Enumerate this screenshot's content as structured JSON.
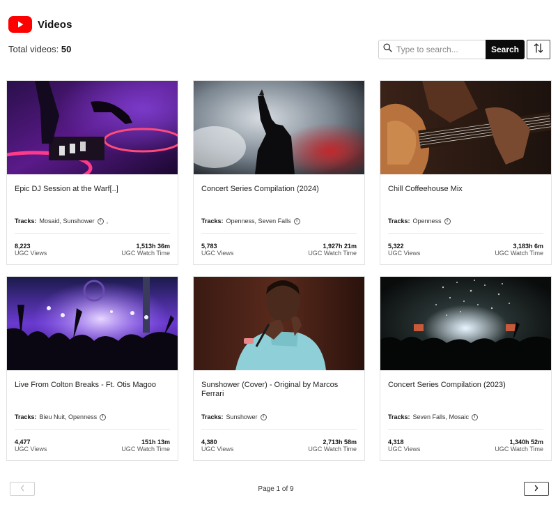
{
  "header": {
    "title": "Videos",
    "logo_icon": "youtube-logo-icon",
    "brand_color": "#ff0000"
  },
  "summary": {
    "label": "Total videos:",
    "count": "50"
  },
  "search": {
    "placeholder": "Type to search...",
    "button_label": "Search",
    "icon": "search-icon"
  },
  "sort": {
    "icon": "sort-arrows-icon"
  },
  "videos": [
    {
      "title": "Epic DJ Session at the Warf[..]",
      "tracks_label": "Tracks:",
      "tracks": "Mosaid, Sunshower",
      "tracks_suffix": ",",
      "views": "8,223",
      "views_label": "UGC Views",
      "watch_time": "1,513h 36m",
      "watch_label": "UGC Watch Time",
      "thumbnail": "dj-decks-purple"
    },
    {
      "title": "Concert Series Compilation (2024)",
      "tracks_label": "Tracks:",
      "tracks": "Openness, Seven Falls",
      "tracks_suffix": "",
      "views": "5,783",
      "views_label": "UGC Views",
      "watch_time": "1,927h 21m",
      "watch_label": "UGC Watch Time",
      "thumbnail": "singer-in-smoke"
    },
    {
      "title": "Chill Coffeehouse Mix",
      "tracks_label": "Tracks:",
      "tracks": "Openness",
      "tracks_suffix": "",
      "views": "5,322",
      "views_label": "UGC Views",
      "watch_time": "3,183h 6m",
      "watch_label": "UGC Watch Time",
      "thumbnail": "acoustic-guitar"
    },
    {
      "title": "Live From Colton Breaks - Ft. Otis Magoo",
      "tracks_label": "Tracks:",
      "tracks": "Bieu Nuit, Openness",
      "tracks_suffix": "",
      "views": "4,477",
      "views_label": "UGC Views",
      "watch_time": "151h 13m",
      "watch_label": "UGC Watch Time",
      "thumbnail": "festival-crowd-purple"
    },
    {
      "title": "Sunshower (Cover) - Original by Marcos Ferrari",
      "tracks_label": "Tracks:",
      "tracks": "Sunshower",
      "tracks_suffix": "",
      "views": "4,380",
      "views_label": "UGC Views",
      "watch_time": "2,713h 58m",
      "watch_label": "UGC Watch Time",
      "thumbnail": "singer-with-mic"
    },
    {
      "title": "Concert Series Compilation (2023)",
      "tracks_label": "Tracks:",
      "tracks": "Seven Falls, Mosaic",
      "tracks_suffix": "",
      "views": "4,318",
      "views_label": "UGC Views",
      "watch_time": "1,340h 52m",
      "watch_label": "UGC Watch Time",
      "thumbnail": "concert-confetti"
    }
  ],
  "pagination": {
    "label": "Page 1 of 9",
    "prev_icon": "chevron-left-icon",
    "next_icon": "chevron-right-icon"
  }
}
